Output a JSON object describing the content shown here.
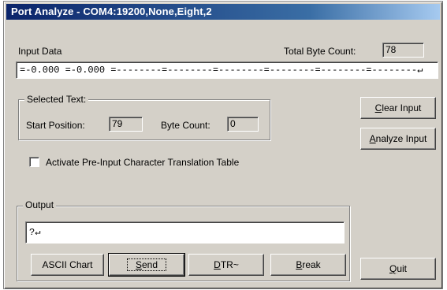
{
  "window": {
    "title": "Port Analyze - COM4:19200,None,Eight,2"
  },
  "input": {
    "label": "Input Data",
    "total_label": "Total Byte Count:",
    "total_value": "78",
    "data": "=-0.000 =-0.000 =--------=--------=--------=--------=--------=--------↵"
  },
  "selected": {
    "group_title": "Selected Text:",
    "start_label": "Start Position:",
    "start_value": "79",
    "count_label": "Byte Count:",
    "count_value": "0"
  },
  "checkbox": {
    "label": "Activate Pre-Input Character Translation Table",
    "checked": false
  },
  "output": {
    "group_title": "Output",
    "value": "?↵"
  },
  "buttons": {
    "clear_input": {
      "mn": "C",
      "rest": "lear Input"
    },
    "analyze_input": {
      "mn": "A",
      "rest": "nalyze Input"
    },
    "ascii_chart": "ASCII Chart",
    "send": {
      "mn": "S",
      "rest": "end"
    },
    "dtr": {
      "mn": "D",
      "rest": "TR~"
    },
    "break": {
      "mn": "B",
      "rest": "reak"
    },
    "quit": {
      "mn": "Q",
      "rest": "uit"
    }
  }
}
